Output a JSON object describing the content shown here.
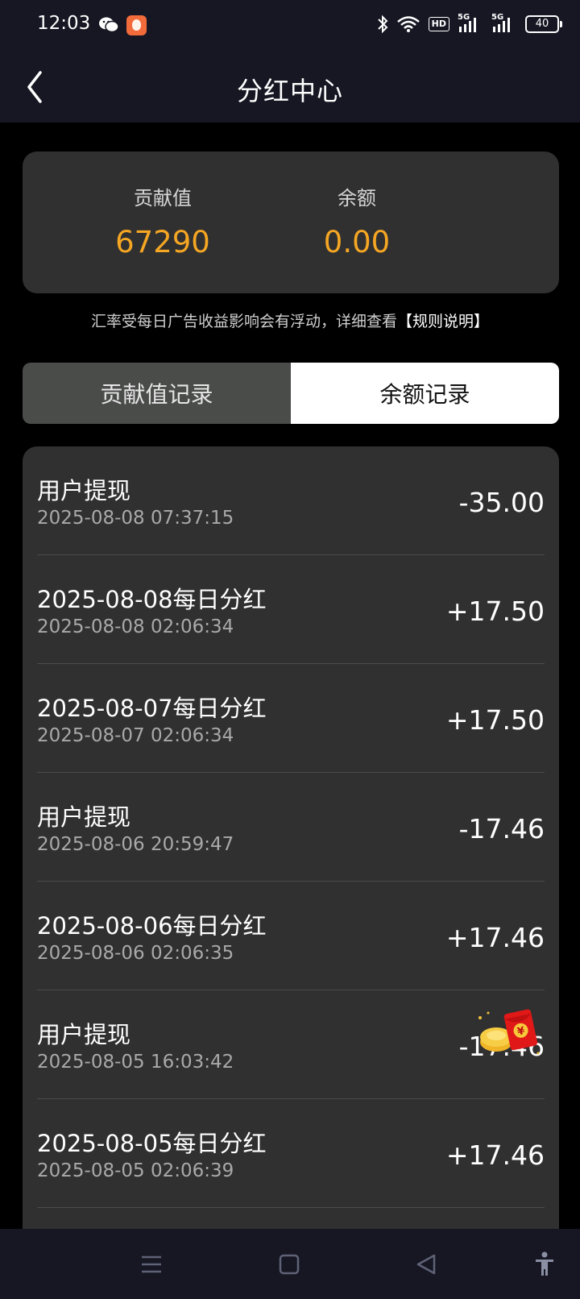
{
  "status_bar": {
    "time": "12:03",
    "hd_label": "HD",
    "net_label_1": "5G",
    "net_label_2": "5G",
    "battery": "40"
  },
  "header": {
    "title": "分红中心"
  },
  "summary": {
    "contribution_label": "贡献值",
    "contribution_value": "67290",
    "balance_label": "余额",
    "balance_value": "0.00"
  },
  "notice": {
    "text": "汇率受每日广告收益影响会有浮动，详细查看",
    "link": "【规则说明】"
  },
  "tabs": [
    {
      "label": "贡献值记录",
      "active": false
    },
    {
      "label": "余额记录",
      "active": true
    }
  ],
  "records": [
    {
      "title": "用户提现",
      "time": "2025-08-08 07:37:15",
      "amount": "-35.00"
    },
    {
      "title": "2025-08-08每日分红",
      "time": "2025-08-08 02:06:34",
      "amount": "+17.50"
    },
    {
      "title": "2025-08-07每日分红",
      "time": "2025-08-07 02:06:34",
      "amount": "+17.50"
    },
    {
      "title": "用户提现",
      "time": "2025-08-06 20:59:47",
      "amount": "-17.46"
    },
    {
      "title": "2025-08-06每日分红",
      "time": "2025-08-06 02:06:35",
      "amount": "+17.46"
    },
    {
      "title": "用户提现",
      "time": "2025-08-05 16:03:42",
      "amount": "-17.46"
    },
    {
      "title": "2025-08-05每日分红",
      "time": "2025-08-05 02:06:39",
      "amount": "+17.46"
    }
  ],
  "colors": {
    "accent": "#f5a623",
    "card": "#303030",
    "header": "#171724"
  },
  "icons": {
    "back": "chevron-left-icon",
    "wechat": "wechat-icon",
    "red_packet": "red-packet-icon",
    "nav_menu": "menu-icon",
    "nav_home": "square-icon",
    "nav_back": "triangle-back-icon",
    "accessibility": "accessibility-icon"
  }
}
